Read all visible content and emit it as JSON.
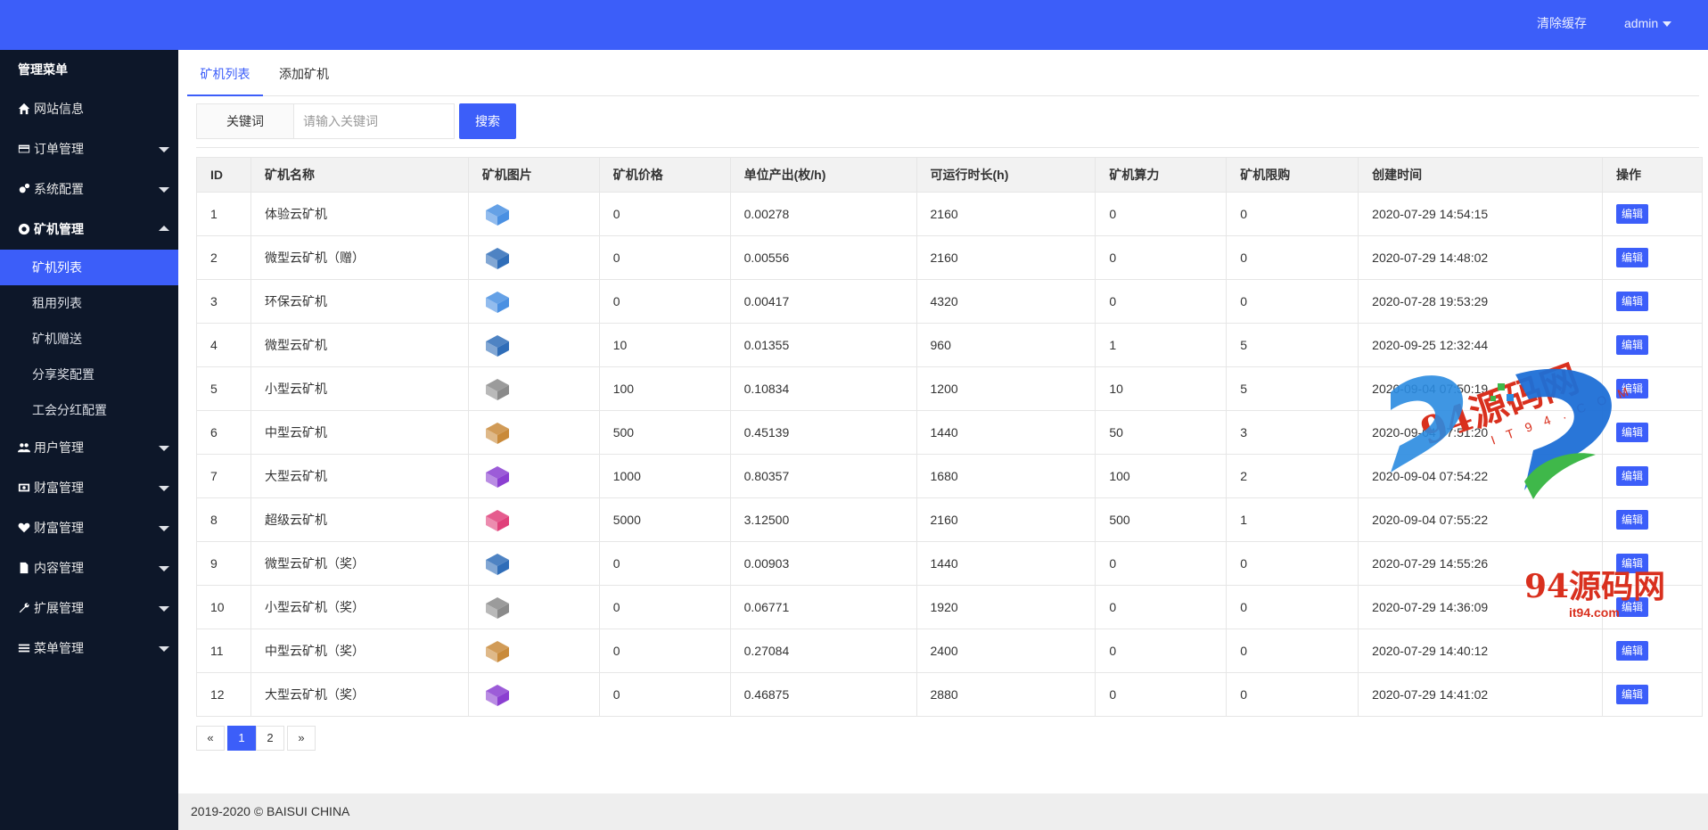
{
  "topbar": {
    "clear_cache": "清除缓存",
    "user": "admin"
  },
  "sidebar": {
    "heading": "管理菜单",
    "items": [
      {
        "label": "网站信息",
        "icon": "home-icon"
      },
      {
        "label": "订单管理",
        "icon": "card-icon"
      },
      {
        "label": "系统配置",
        "icon": "gears-icon"
      },
      {
        "label": "矿机管理",
        "icon": "empire-icon"
      },
      {
        "label": "用户管理",
        "icon": "users-icon"
      },
      {
        "label": "财富管理",
        "icon": "money-icon"
      },
      {
        "label": "财富管理",
        "icon": "heartbeat-icon"
      },
      {
        "label": "内容管理",
        "icon": "file-icon"
      },
      {
        "label": "扩展管理",
        "icon": "wrench-icon"
      },
      {
        "label": "菜单管理",
        "icon": "bars-icon"
      }
    ],
    "sub_items": [
      "矿机列表",
      "租用列表",
      "矿机赠送",
      "分享奖配置",
      "工会分红配置"
    ]
  },
  "tabs": [
    "矿机列表",
    "添加矿机"
  ],
  "search": {
    "label": "关键词",
    "placeholder": "请输入关键词",
    "button": "搜索"
  },
  "table": {
    "headers": [
      "ID",
      "矿机名称",
      "矿机图片",
      "矿机价格",
      "单位产出(枚/h)",
      "可运行时长(h)",
      "矿机算力",
      "矿机限购",
      "创建时间",
      "操作"
    ],
    "action_label": "编辑",
    "rows": [
      {
        "id": "1",
        "name": "体验云矿机",
        "img": "#4a90e2",
        "price": "0",
        "output": "0.00278",
        "hours": "2160",
        "power": "0",
        "limit": "0",
        "created": "2020-07-29 14:54:15"
      },
      {
        "id": "2",
        "name": "微型云矿机（赠）",
        "img": "#2f6db8",
        "price": "0",
        "output": "0.00556",
        "hours": "2160",
        "power": "0",
        "limit": "0",
        "created": "2020-07-29 14:48:02"
      },
      {
        "id": "3",
        "name": "环保云矿机",
        "img": "#4a90e2",
        "price": "0",
        "output": "0.00417",
        "hours": "4320",
        "power": "0",
        "limit": "0",
        "created": "2020-07-28 19:53:29"
      },
      {
        "id": "4",
        "name": "微型云矿机",
        "img": "#2f6db8",
        "price": "10",
        "output": "0.01355",
        "hours": "960",
        "power": "1",
        "limit": "5",
        "created": "2020-09-25 12:32:44"
      },
      {
        "id": "5",
        "name": "小型云矿机",
        "img": "#8a8a8a",
        "price": "100",
        "output": "0.10834",
        "hours": "1200",
        "power": "10",
        "limit": "5",
        "created": "2020-09-04 07:50:19"
      },
      {
        "id": "6",
        "name": "中型云矿机",
        "img": "#c98a3a",
        "price": "500",
        "output": "0.45139",
        "hours": "1440",
        "power": "50",
        "limit": "3",
        "created": "2020-09-04 07:51:20"
      },
      {
        "id": "7",
        "name": "大型云矿机",
        "img": "#8b3fd1",
        "price": "1000",
        "output": "0.80357",
        "hours": "1680",
        "power": "100",
        "limit": "2",
        "created": "2020-09-04 07:54:22"
      },
      {
        "id": "8",
        "name": "超级云矿机",
        "img": "#e0407a",
        "price": "5000",
        "output": "3.12500",
        "hours": "2160",
        "power": "500",
        "limit": "1",
        "created": "2020-09-04 07:55:22"
      },
      {
        "id": "9",
        "name": "微型云矿机（奖）",
        "img": "#2f6db8",
        "price": "0",
        "output": "0.00903",
        "hours": "1440",
        "power": "0",
        "limit": "0",
        "created": "2020-07-29 14:55:26"
      },
      {
        "id": "10",
        "name": "小型云矿机（奖）",
        "img": "#8a8a8a",
        "price": "0",
        "output": "0.06771",
        "hours": "1920",
        "power": "0",
        "limit": "0",
        "created": "2020-07-29 14:36:09"
      },
      {
        "id": "11",
        "name": "中型云矿机（奖）",
        "img": "#c98a3a",
        "price": "0",
        "output": "0.27084",
        "hours": "2400",
        "power": "0",
        "limit": "0",
        "created": "2020-07-29 14:40:12"
      },
      {
        "id": "12",
        "name": "大型云矿机（奖）",
        "img": "#8b3fd1",
        "price": "0",
        "output": "0.46875",
        "hours": "2880",
        "power": "0",
        "limit": "0",
        "created": "2020-07-29 14:41:02"
      }
    ]
  },
  "pagination": {
    "prev": "«",
    "pages": [
      "1",
      "2"
    ],
    "current": "1",
    "next": "»"
  },
  "footer": {
    "copyright": "2019-2020 © BAISUI CHINA"
  },
  "watermark": {
    "text1": "94源码网",
    "text2": "IT94.COM",
    "text3": "94源码网",
    "text4": "it94.com"
  },
  "colors": {
    "primary": "#3c5ef9",
    "sidebar": "#0d1729"
  }
}
